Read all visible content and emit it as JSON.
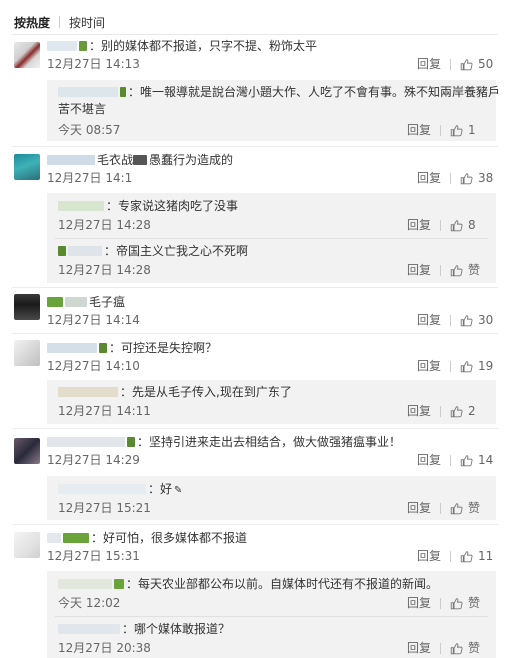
{
  "tabs": [
    {
      "label": "按热度"
    },
    {
      "label": "按时间"
    }
  ],
  "actions": {
    "reply": "回复",
    "like": "赞"
  },
  "comments": [
    {
      "text": "：别的媒体都不报道，只字不提、粉饰太平",
      "time": "12月27日 14:13",
      "likes": "50",
      "replies": [
        {
          "text": "：唯一報導就是說台灣小題大作、人吃了不會有事。殊不知兩岸養豬戶",
          "text2": "苦不堪言",
          "time": "今天 08:57",
          "likes": "1"
        }
      ]
    },
    {
      "text": "毛衣战",
      "text_b": "愚蠢行为造成的",
      "time": "12月27日 14:1",
      "likes": "38",
      "replies": [
        {
          "text": "：专家说这猪肉吃了没事",
          "time": "12月27日 14:28",
          "likes": "8"
        },
        {
          "text": "：帝国主义亡我之心不死啊",
          "time": "12月27日 14:28",
          "likes": "赞"
        }
      ]
    },
    {
      "text": "毛子瘟",
      "time": "12月27日 14:14",
      "likes": "30",
      "replies": []
    },
    {
      "text": "：可控还是失控啊？",
      "time": "12月27日 14:10",
      "likes": "19",
      "replies": [
        {
          "text": "：先是从毛子传入,现在到广东了",
          "time": "12月27日 14:11",
          "likes": "2"
        }
      ]
    },
    {
      "text": "：坚持引进来走出去相结合，做大做强猪瘟事业！",
      "time": "12月27日 14:29",
      "likes": "14",
      "replies": [
        {
          "text": "：好",
          "time": "12月27日 15:21",
          "likes": "赞"
        }
      ]
    },
    {
      "text": "：好可怕，很多媒体都不报道",
      "time": "12月27日 15:31",
      "likes": "11",
      "replies": [
        {
          "text": "：每天农业部都公布以前。自媒体时代还有不报道的新闻。",
          "time": "今天 12:02",
          "likes": "赞"
        },
        {
          "text": "：哪个媒体敢报道？",
          "time": "12月27日 20:38",
          "likes": "赞"
        }
      ]
    }
  ]
}
